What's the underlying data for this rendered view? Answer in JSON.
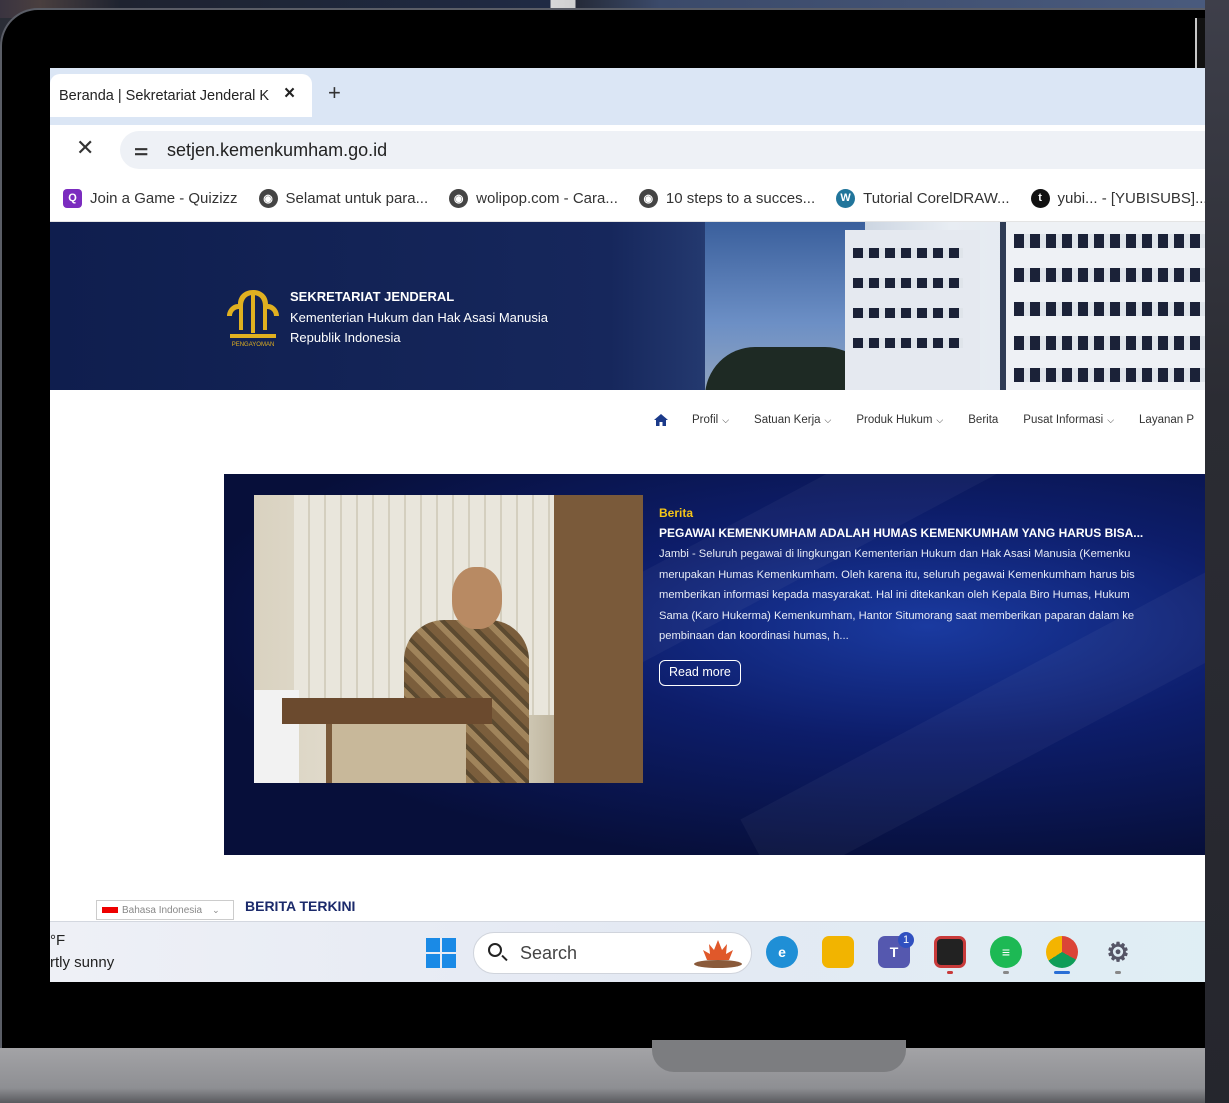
{
  "browser": {
    "tab_title": "Beranda | Sekretariat Jenderal K",
    "tab_close": "×",
    "new_tab": "+",
    "stop": "✕",
    "site_info_icon": "⚌",
    "url": "setjen.kemenkumham.go.id"
  },
  "bookmarks": [
    {
      "label": "Join a Game - Quizizz",
      "icon": "Q"
    },
    {
      "label": "Selamat untuk para...",
      "icon": "globe"
    },
    {
      "label": "wolipop.com - Cara...",
      "icon": "globe"
    },
    {
      "label": "10 steps to a succes...",
      "icon": "globe"
    },
    {
      "label": "Tutorial CorelDRAW...",
      "icon": "W"
    },
    {
      "label": "yubi... - [YUBISUBS]...",
      "icon": "t"
    }
  ],
  "site": {
    "org_title": "SEKRETARIAT JENDERAL",
    "org_sub1": "Kementerian Hukum dan Hak Asasi Manusia",
    "org_sub2": "Republik Indonesia",
    "logo_caption": "PENGAYOMAN"
  },
  "nav": [
    {
      "label": "Profil",
      "dropdown": true
    },
    {
      "label": "Satuan Kerja",
      "dropdown": true
    },
    {
      "label": "Produk Hukum",
      "dropdown": true
    },
    {
      "label": "Berita",
      "dropdown": false
    },
    {
      "label": "Pusat Informasi",
      "dropdown": true
    },
    {
      "label": "Layanan P",
      "dropdown": false
    }
  ],
  "hero": {
    "category": "Berita",
    "title": "PEGAWAI KEMENKUMHAM ADALAH HUMAS KEMENKUMHAM YANG HARUS BISA...",
    "lines": [
      "Jambi - Seluruh pegawai di lingkungan Kementerian Hukum dan Hak Asasi Manusia (Kemenku",
      "merupakan Humas Kemenkumham. Oleh karena itu, seluruh pegawai Kemenkumham harus bis",
      "memberikan informasi kepada masyarakat. Hal ini ditekankan oleh Kepala Biro Humas, Hukum",
      "Sama (Karo Hukerma) Kemenkumham, Hantor Situmorang saat memberikan paparan dalam ke",
      "pembinaan dan koordinasi humas, h..."
    ],
    "read_more": "Read more"
  },
  "language": {
    "selected": "Bahasa Indonesia",
    "chev": "⌄"
  },
  "section_title": "BERITA TERKINI",
  "taskbar": {
    "weather_temp": "°F",
    "weather_desc": "rtly sunny",
    "search_label": "Search",
    "teams_badge": "1"
  },
  "colors": {
    "header_navy": "#0f1e4e",
    "accent_gold": "#f5c518",
    "hero_blue": "#0d1d6a",
    "section_title": "#1b2a6b"
  }
}
